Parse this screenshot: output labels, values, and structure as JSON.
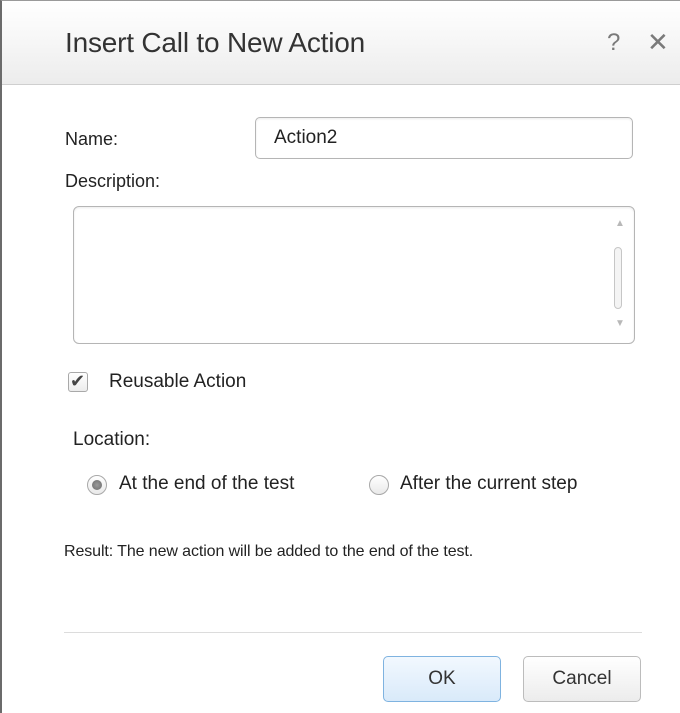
{
  "dialog": {
    "title": "Insert Call to New Action",
    "help_glyph": "?",
    "close_glyph": "✕"
  },
  "form": {
    "name_label": "Name:",
    "name_value": "Action2",
    "description_label": "Description:",
    "description_value": "",
    "reusable_label": "Reusable Action",
    "reusable_checked": true,
    "location_label": "Location:",
    "location_options": [
      {
        "label": "At the end of the test",
        "selected": true
      },
      {
        "label": "After the current step",
        "selected": false
      }
    ],
    "result_text": "Result: The new action will be added to the end of the test."
  },
  "buttons": {
    "ok_label": "OK",
    "cancel_label": "Cancel"
  },
  "icons": {
    "help": "help-icon",
    "close": "close-icon",
    "check": "check-icon",
    "scroll_up": "scroll-up-arrow",
    "scroll_down": "scroll-down-arrow"
  },
  "colors": {
    "ok_border": "#7fb3e0",
    "ok_fill": "#d9eafa",
    "title_text": "#333333"
  }
}
